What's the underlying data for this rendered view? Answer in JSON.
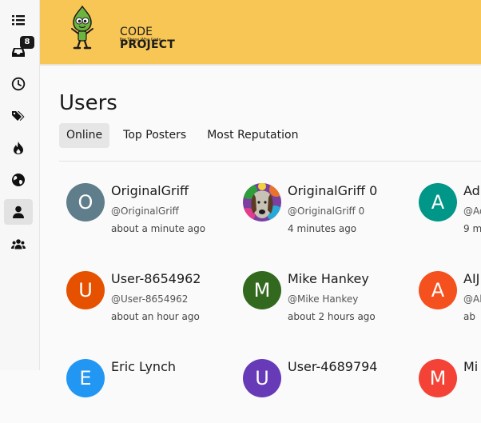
{
  "sidebar": {
    "items": [
      {
        "name": "list-icon"
      },
      {
        "name": "inbox-icon",
        "badge": "8"
      },
      {
        "name": "clock-icon"
      },
      {
        "name": "tags-icon"
      },
      {
        "name": "fire-icon"
      },
      {
        "name": "globe-icon"
      },
      {
        "name": "user-icon",
        "active": true
      },
      {
        "name": "users-icon"
      }
    ]
  },
  "header": {
    "brand_prefix": "CODE",
    "brand_suffix": "PROJECT",
    "tagline": "For Those Who Code",
    "background": "#f8c654"
  },
  "page": {
    "title": "Users"
  },
  "tabs": [
    {
      "label": "Online",
      "active": true
    },
    {
      "label": "Top Posters"
    },
    {
      "label": "Most Reputation"
    }
  ],
  "users": [
    {
      "initial": "O",
      "name": "OriginalGriff",
      "handle": "@OriginalGriff",
      "time": "about a minute ago",
      "color": "#607d8b"
    },
    {
      "initial": "",
      "name": "OriginalGriff 0",
      "handle": "@OriginalGriff 0",
      "time": "4 minutes ago",
      "color": "#7a3fa0",
      "photo": true
    },
    {
      "initial": "A",
      "name": "Ad",
      "handle": "@Ad",
      "time": "9 m",
      "color": "#009688"
    },
    {
      "initial": "U",
      "name": "User-8654962",
      "handle": "@User-8654962",
      "time": "about an hour ago",
      "color": "#e65100"
    },
    {
      "initial": "M",
      "name": "Mike Hankey",
      "handle": "@Mike Hankey",
      "time": "about 2 hours ago",
      "color": "#33691e"
    },
    {
      "initial": "A",
      "name": "AIJ",
      "handle": "@Al",
      "time": "ab",
      "color": "#f4511e"
    },
    {
      "initial": "E",
      "name": "Eric Lynch",
      "handle": "",
      "time": "",
      "color": "#2196f3"
    },
    {
      "initial": "U",
      "name": "User-4689794",
      "handle": "",
      "time": "",
      "color": "#673ab7"
    },
    {
      "initial": "M",
      "name": "Mi",
      "handle": "",
      "time": "",
      "color": "#f44336"
    }
  ]
}
